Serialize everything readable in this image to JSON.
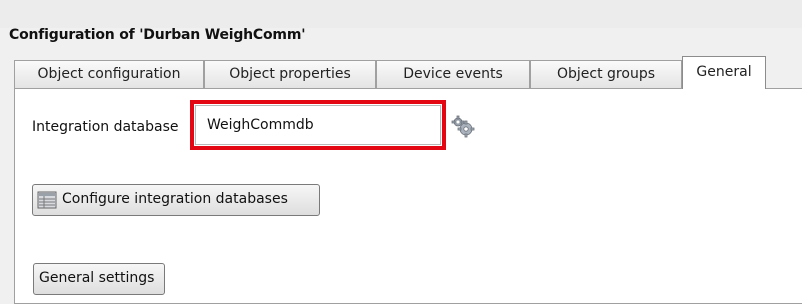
{
  "window": {
    "title": "Configuration of 'Durban WeighComm'"
  },
  "tabs": [
    {
      "label": "Object configuration",
      "active": false
    },
    {
      "label": "Object properties",
      "active": false
    },
    {
      "label": "Device events",
      "active": false
    },
    {
      "label": "Object groups",
      "active": false
    },
    {
      "label": "General",
      "active": true
    }
  ],
  "general": {
    "integration_db_label": "Integration database",
    "integration_db_value": "WeighCommdb",
    "configure_db_button": "Configure integration databases",
    "general_settings_button": "General settings"
  },
  "icons": {
    "settings": "gear-icon",
    "database": "database-icon"
  },
  "colors": {
    "highlight": "#e30613"
  }
}
